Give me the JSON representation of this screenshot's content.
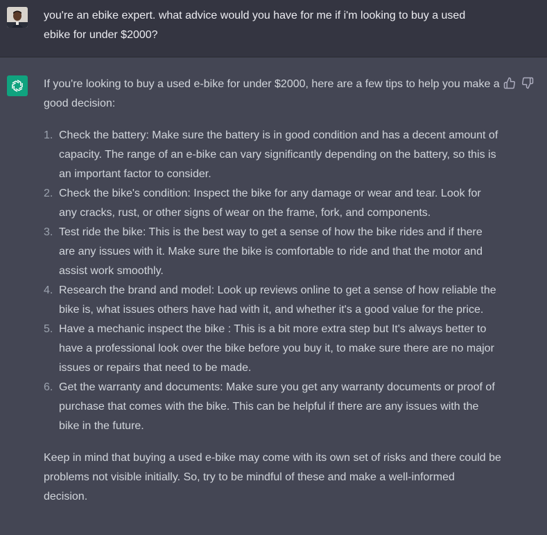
{
  "user_message": {
    "text": "you're an ebike expert. what advice would you have for me if i'm looking to buy a used ebike for under $2000?",
    "avatar": "user-avatar-photo"
  },
  "assistant_message": {
    "logo": "openai-logo-icon",
    "intro": "If you're looking to buy a used e-bike for under $2000, here are a few tips to help you make a good decision:",
    "tips": [
      {
        "num": "1.",
        "text": "Check the battery: Make sure the battery is in good condition and has a decent amount of capacity. The range of an e-bike can vary significantly depending on the battery, so this is an important factor to consider."
      },
      {
        "num": "2.",
        "text": "Check the bike's condition: Inspect the bike for any damage or wear and tear. Look for any cracks, rust, or other signs of wear on the frame, fork, and components."
      },
      {
        "num": "3.",
        "text": "Test ride the bike: This is the best way to get a sense of how the bike rides and if there are any issues with it. Make sure the bike is comfortable to ride and that the motor and assist work smoothly."
      },
      {
        "num": "4.",
        "text": "Research the brand and model: Look up reviews online to get a sense of how reliable the bike is, what issues others have had with it, and whether it's a good value for the price."
      },
      {
        "num": "5.",
        "text": "Have a mechanic inspect the bike : This is a bit more extra step but It's always better to have a professional look over the bike before you buy it, to make sure there are no major issues or repairs that need to be made."
      },
      {
        "num": "6.",
        "text": "Get the warranty and documents: Make sure you get any warranty documents or proof of purchase that comes with the bike. This can be helpful if there are any issues with the bike in the future."
      }
    ],
    "closing": "Keep in mind that buying a used e-bike may come with its own set of risks and there could be problems not visible initially. So, try to be mindful of these and make a well-informed decision."
  },
  "feedback": {
    "thumbs_up": "thumbs-up-icon",
    "thumbs_down": "thumbs-down-icon"
  }
}
